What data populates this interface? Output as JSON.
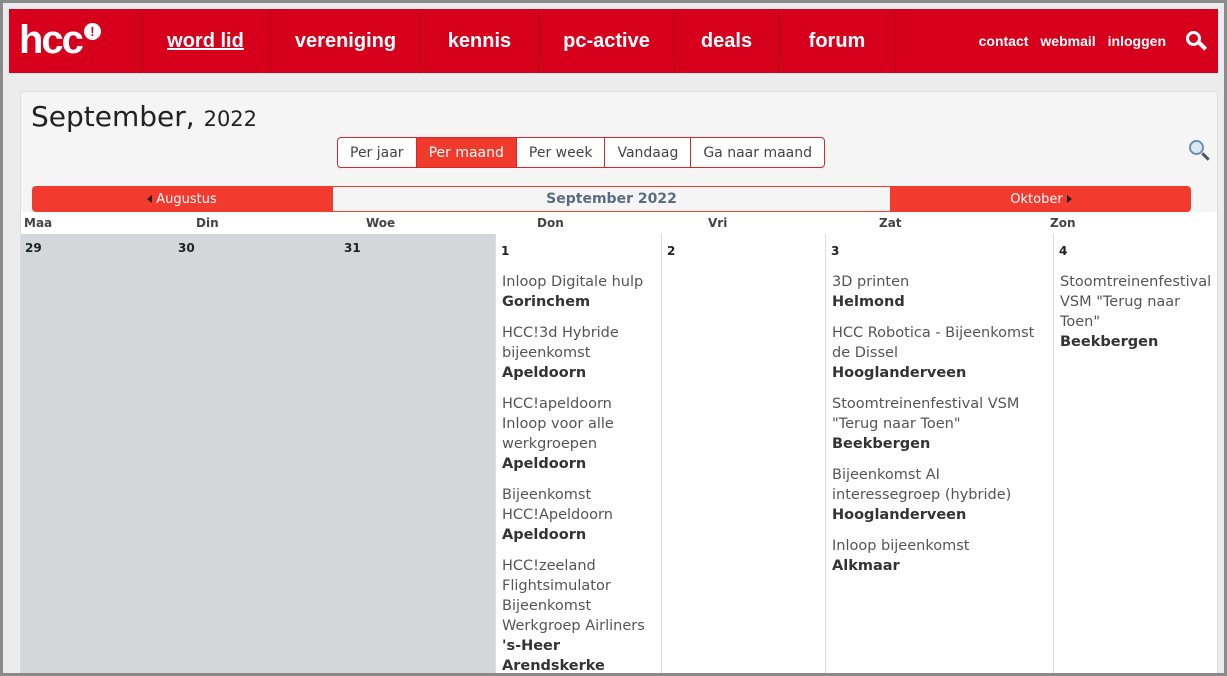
{
  "brand": {
    "logo_text": "hcc",
    "logo_mark": "!"
  },
  "nav": {
    "items": [
      {
        "label": "word lid",
        "active": true
      },
      {
        "label": "vereniging"
      },
      {
        "label": "kennis"
      },
      {
        "label": "pc-active"
      },
      {
        "label": "deals"
      },
      {
        "label": "forum"
      }
    ],
    "utils": [
      "contact",
      "webmail",
      "inloggen"
    ]
  },
  "calendar": {
    "month": "September,",
    "year": "2022",
    "views": [
      "Per jaar",
      "Per maand",
      "Per week",
      "Vandaag",
      "Ga naar maand"
    ],
    "selected_view": "Per maand",
    "prev_label": "Augustus",
    "current_label": "September 2022",
    "next_label": "Oktober",
    "weekdays": [
      "Maa",
      "Din",
      "Woe",
      "Don",
      "Vri",
      "Zat",
      "Zon"
    ],
    "prev_days": [
      "29",
      "30",
      "31"
    ],
    "days": [
      {
        "num": "1",
        "events": [
          {
            "title": "Inloop Digitale hulp",
            "location": "Gorinchem"
          },
          {
            "title": "HCC!3d Hybride bijeenkomst",
            "location": "Apeldoorn"
          },
          {
            "title": "HCC!apeldoorn Inloop voor alle werkgroepen",
            "location": "Apeldoorn"
          },
          {
            "title": "Bijeenkomst HCC!Apeldoorn",
            "location": "Apeldoorn"
          },
          {
            "title": "HCC!zeeland Flightsimulator Bijeenkomst Werkgroep Airliners",
            "location": "'s-Heer Arendskerke"
          }
        ]
      },
      {
        "num": "2",
        "events": []
      },
      {
        "num": "3",
        "events": [
          {
            "title": "3D printen",
            "location": "Helmond"
          },
          {
            "title": "HCC Robotica - Bijeenkomst de Dissel",
            "location": "Hooglanderveen"
          },
          {
            "title": "Stoomtreinenfestival VSM \"Terug naar Toen\"",
            "location": "Beekbergen"
          },
          {
            "title": "Bijeenkomst AI interessegroep (hybride)",
            "location": "Hooglanderveen"
          },
          {
            "title": "Inloop bijeenkomst",
            "location": "Alkmaar"
          }
        ]
      },
      {
        "num": "4",
        "events": [
          {
            "title": "Stoomtreinenfestival VSM \"Terug naar Toen\"",
            "location": "Beekbergen"
          }
        ]
      }
    ]
  },
  "colors": {
    "brand_red": "#d6001c",
    "accent_red": "#f23a2f"
  }
}
